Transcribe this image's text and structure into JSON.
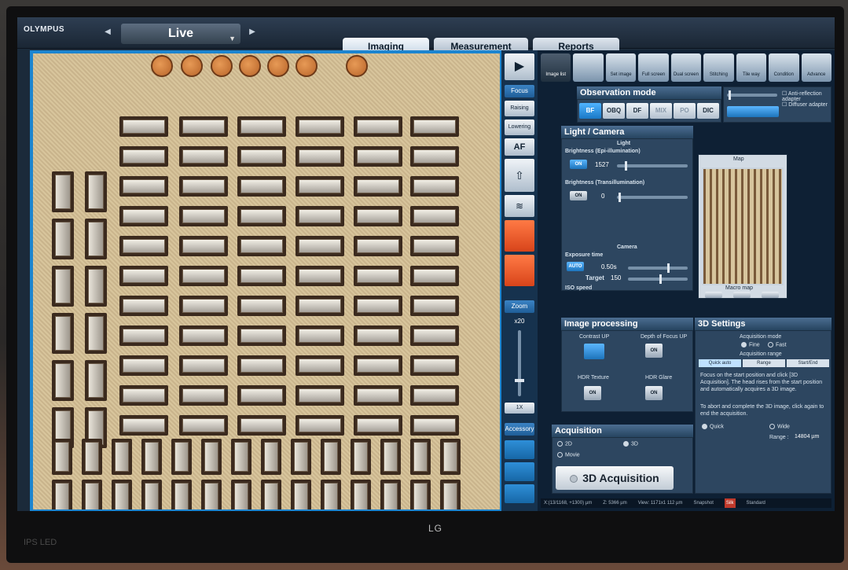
{
  "app": {
    "brand": "OLYMPUS",
    "mode_selector": "Live"
  },
  "tabs": [
    "Imaging",
    "Measurement",
    "Reports"
  ],
  "monitor": {
    "brand": "LG",
    "panel": "IPS LED"
  },
  "ribbon": [
    "Image list",
    "",
    "Set image",
    "Full screen",
    "Dual screen",
    "Stitching",
    "Tile way",
    "Condition",
    "Advance"
  ],
  "toolcol": {
    "focus_label": "Focus",
    "raising_label": "Raising",
    "lowering_label": "Lowering",
    "af_label": "AF",
    "zoom_label": "Zoom",
    "zoom_value": "x20",
    "zoom_reset": "1X",
    "accessory_label": "Accessory"
  },
  "observation": {
    "title": "Observation mode",
    "modes": [
      "BF",
      "OBQ",
      "DF",
      "MIX",
      "PO",
      "DIC"
    ],
    "anti_reflection": "Anti-reflection adapter",
    "diffuser": "Diffuser adapter"
  },
  "light": {
    "title": "Light / Camera",
    "group_light": "Light",
    "epi_label": "Brightness (Epi-illumination)",
    "epi_btn": "ON",
    "epi_value": "1527",
    "trans_label": "Brightness (Transillumination)",
    "trans_btn": "ON",
    "trans_value": "0",
    "group_camera": "Camera",
    "exposure_label": "Exposure time",
    "exposure_btn": "AUTO",
    "exposure_value": "0.50s",
    "target_label": "Target",
    "target_value": "150",
    "iso_label": "ISO speed"
  },
  "map": {
    "title": "Map",
    "footer": "Macro map"
  },
  "image_processing": {
    "title": "Image processing",
    "contrast": "Contrast UP",
    "depth": "Depth of Focus UP",
    "depth_btn": "ON",
    "hdr_texture": "HDR Texture",
    "hdr_texture_btn": "ON",
    "hdr_glare": "HDR Glare",
    "hdr_glare_btn": "ON"
  },
  "settings3d": {
    "title": "3D Settings",
    "acq_mode": "Acquisition mode",
    "fine": "Fine",
    "fast": "Fast",
    "acq_range": "Acquisition range",
    "subtabs": [
      "Quick auto",
      "Range",
      "Start/End"
    ],
    "instruction": "Focus on the start position and click [3D Acquisition]. The head rises from the start position and automatically acquires a 3D image.",
    "abort": "To abort and complete the 3D image, click again to end the acquisition.",
    "quick": "Quick",
    "wide": "Wide",
    "range_label": "Range :",
    "range_value": "14804 µm"
  },
  "acquisition": {
    "title": "Acquisition",
    "opt_2d": "2D",
    "opt_3d": "3D",
    "movie": "Movie",
    "button": "3D Acquisition"
  },
  "status": [
    "X:(13/1168, +1300) µm",
    "Z: 5366 µm",
    "View: 1171x1 112 µm",
    "Snapshot",
    "Silk",
    "Standard"
  ]
}
